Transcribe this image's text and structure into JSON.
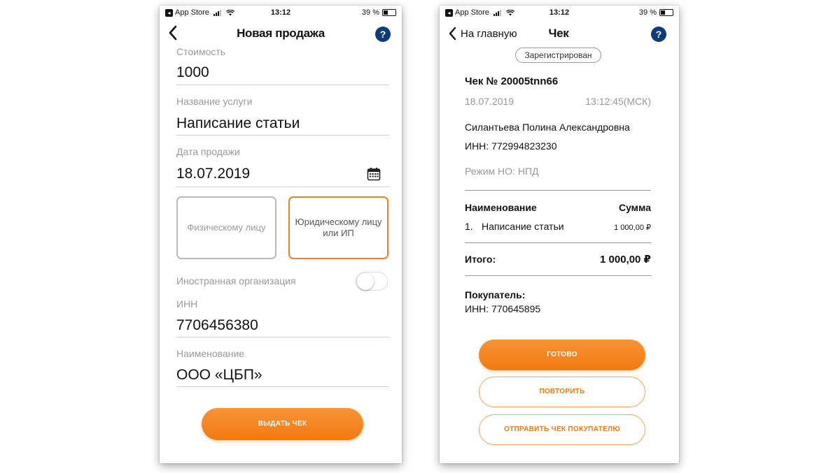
{
  "left": {
    "status": {
      "carrier": "App Store",
      "time": "13:12",
      "battery": "39 %"
    },
    "nav": {
      "title": "Новая продажа",
      "help": "?"
    },
    "form": {
      "cost_label": "Стоимость",
      "cost_value": "1000",
      "service_label": "Название услуги",
      "service_value": "Написание статьи",
      "date_label": "Дата продажи",
      "date_value": "18.07.2019",
      "choice_physical": "Физическому лицу",
      "choice_legal": "Юридическому лицу или ИП",
      "foreign_label": "Иностранная организация",
      "foreign_on": false,
      "inn_label": "ИНН",
      "inn_value": "7706456380",
      "name_label": "Наименование",
      "name_value": "ООО «ЦБП»"
    },
    "submit_label": "ВЫДАТЬ ЧЕК"
  },
  "right": {
    "status": {
      "carrier": "App Store",
      "time": "13:12",
      "battery": "39 %"
    },
    "nav": {
      "back": "На главную",
      "title": "Чек",
      "help": "?"
    },
    "badge": "Зарегистрирован",
    "receipt": {
      "number": "Чек № 20005tnn66",
      "date": "18.07.2019",
      "time": "13:12:45(МСК)",
      "seller_name": "Силантьева Полина Александровна",
      "seller_inn": "ИНН: 772994823230",
      "tax_mode": "Режим НО: НПД",
      "col_name": "Наименование",
      "col_sum": "Сумма",
      "items": [
        {
          "index": "1.",
          "name": "Написание статьи",
          "sum": "1 000,00 ₽"
        }
      ],
      "total_label": "Итого:",
      "total_value": "1 000,00 ₽",
      "buyer_label": "Покупатель:",
      "buyer_inn": "ИНН: 770645895"
    },
    "buttons": {
      "done": "ГОТОВО",
      "repeat": "ПОВТОРИТЬ",
      "send": "ОТПРАВИТЬ ЧЕК ПОКУПАТЕЛЮ"
    }
  },
  "colors": {
    "accent": "#f27a10",
    "help": "#0f3c78"
  }
}
